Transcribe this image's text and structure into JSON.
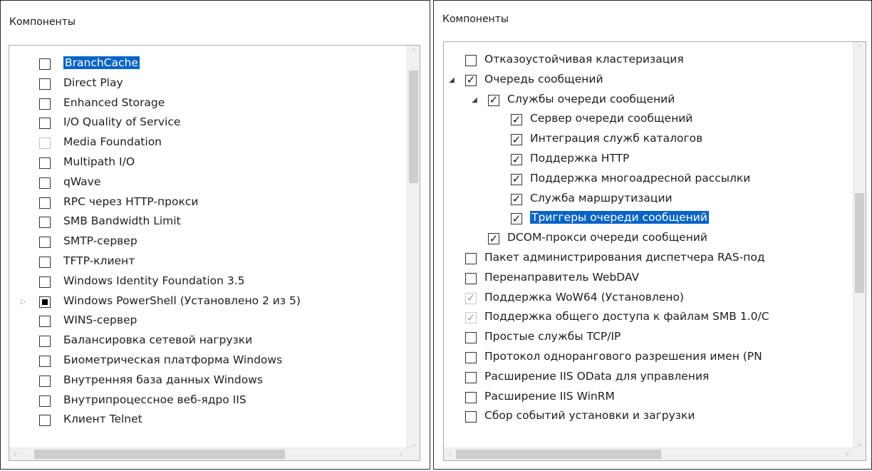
{
  "left": {
    "title": "Компоненты",
    "items": [
      {
        "label": "BranchCache",
        "state": "unchecked",
        "selected": true
      },
      {
        "label": "Direct Play",
        "state": "unchecked"
      },
      {
        "label": "Enhanced Storage",
        "state": "unchecked"
      },
      {
        "label": "I/O Quality of Service",
        "state": "unchecked"
      },
      {
        "label": "Media Foundation",
        "state": "unchecked",
        "light": true
      },
      {
        "label": "Multipath I/O",
        "state": "unchecked"
      },
      {
        "label": "qWave",
        "state": "unchecked"
      },
      {
        "label": "RPC через HTTP-прокси",
        "state": "unchecked"
      },
      {
        "label": "SMB Bandwidth Limit",
        "state": "unchecked"
      },
      {
        "label": "SMTP-сервер",
        "state": "unchecked"
      },
      {
        "label": "TFTP-клиент",
        "state": "unchecked"
      },
      {
        "label": "Windows Identity Foundation 3.5",
        "state": "unchecked"
      },
      {
        "label": "Windows PowerShell (Установлено 2 из 5)",
        "state": "partial",
        "expander": "collapsed"
      },
      {
        "label": "WINS-сервер",
        "state": "unchecked"
      },
      {
        "label": "Балансировка сетевой нагрузки",
        "state": "unchecked"
      },
      {
        "label": "Биометрическая платформа Windows",
        "state": "unchecked"
      },
      {
        "label": "Внутренняя база данных Windows",
        "state": "unchecked"
      },
      {
        "label": "Внутрипроцессное веб-ядро IIS",
        "state": "unchecked"
      },
      {
        "label": "Клиент Telnet",
        "state": "unchecked"
      }
    ]
  },
  "right": {
    "title": "Компоненты",
    "items": [
      {
        "label": "Отказоустойчивая кластеризация",
        "state": "unchecked",
        "indent": 0
      },
      {
        "label": "Очередь сообщений",
        "state": "checked",
        "indent": 0,
        "expander": "expanded"
      },
      {
        "label": "Службы очереди сообщений",
        "state": "checked",
        "indent": 1,
        "expander": "expanded"
      },
      {
        "label": "Сервер очереди сообщений",
        "state": "checked",
        "indent": 2
      },
      {
        "label": "Интеграция служб каталогов",
        "state": "checked",
        "indent": 2
      },
      {
        "label": "Поддержка HTTP",
        "state": "checked",
        "indent": 2
      },
      {
        "label": "Поддержка многоадресной рассылки",
        "state": "checked",
        "indent": 2
      },
      {
        "label": "Служба маршрутизации",
        "state": "checked",
        "indent": 2
      },
      {
        "label": "Триггеры очереди сообщений",
        "state": "checked",
        "indent": 2,
        "selected": true
      },
      {
        "label": "DCOM-прокси очереди сообщений",
        "state": "checked",
        "indent": 1
      },
      {
        "label": "Пакет администрирования диспетчера RAS-под",
        "state": "unchecked",
        "indent": 0
      },
      {
        "label": "Перенаправитель WebDAV",
        "state": "unchecked",
        "indent": 0
      },
      {
        "label": "Поддержка WoW64 (Установлено)",
        "state": "disabled-checked",
        "indent": 0
      },
      {
        "label": "Поддержка общего доступа к файлам SMB 1.0/C",
        "state": "disabled-checked",
        "indent": 0
      },
      {
        "label": "Простые службы TCP/IP",
        "state": "unchecked",
        "indent": 0
      },
      {
        "label": "Протокол однорангового разрешения имен (PN",
        "state": "unchecked",
        "indent": 0
      },
      {
        "label": "Расширение IIS OData для управления",
        "state": "unchecked",
        "indent": 0
      },
      {
        "label": "Расширение IIS WinRM",
        "state": "unchecked",
        "indent": 0
      },
      {
        "label": "Сбор событий установки и загрузки",
        "state": "unchecked",
        "indent": 0
      }
    ]
  },
  "icons": {
    "checkmark": "✓",
    "expanded": "◢",
    "collapsed": "▷",
    "arrow_up": "⌃",
    "arrow_down": "⌄",
    "arrow_left": "‹",
    "arrow_right": "›"
  },
  "colors": {
    "selection": "#0a64c8",
    "border": "#ababab"
  }
}
